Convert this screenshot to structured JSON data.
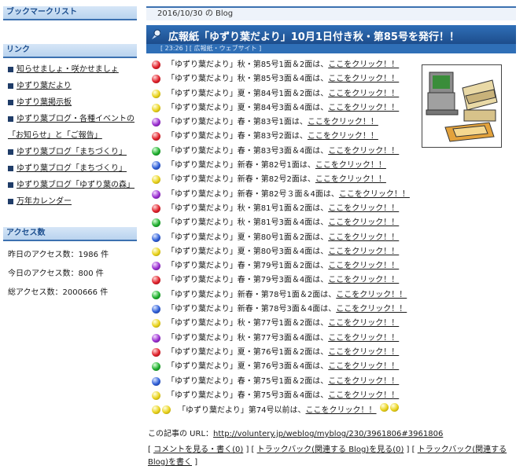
{
  "sidebar": {
    "bookmark_title": "ブックマークリスト",
    "links_title": "リンク",
    "links": [
      "知らせましょ・咲かせましょ",
      "ゆずり葉だより",
      "ゆずり葉掲示板",
      "ゆずり葉ブログ・各種イベントの",
      "「お知らせ」と「ご報告」",
      "ゆずり葉ブログ「まちづくり」",
      "ゆずり葉ブログ「まちづくり」",
      "ゆずり葉ブログ「ゆずり葉の森」",
      "万年カレンダー"
    ],
    "access_title": "アクセス数",
    "access": {
      "yesterday": "昨日のアクセス数：1986 件",
      "today": "今日のアクセス数：800 件",
      "total": "総アクセス数：2000666 件"
    }
  },
  "main": {
    "date_label": "2016/10/30 の Blog",
    "title": "広報紙「ゆずり葉だより」10月1日付き秋・第85号を発行！！",
    "subtitle": "[ 23:26 ] [ 広報紙・ウェブサイト ]",
    "entries": [
      {
        "color": "red",
        "text": "「ゆずり葉だより」秋・第85号1面＆2面は、",
        "link": "ここをクリック！！"
      },
      {
        "color": "red",
        "text": "「ゆずり葉だより」秋・第85号3面＆4面は、",
        "link": "ここをクリック！！"
      },
      {
        "color": "yellow",
        "text": "「ゆずり葉だより」夏・第84号1面＆2面は、",
        "link": "ここをクリック！！"
      },
      {
        "color": "yellow",
        "text": "「ゆずり葉だより」夏・第84号3面＆4面は、",
        "link": "ここをクリック！！"
      },
      {
        "color": "purple",
        "text": "「ゆずり葉だより」春・第83号1面は、",
        "link": "ここをクリック！！"
      },
      {
        "color": "red",
        "text": "「ゆずり葉だより」春・第83号2面は、",
        "link": "ここをクリック！！"
      },
      {
        "color": "green",
        "text": "「ゆずり葉だより」春・第83号3面＆4面は、",
        "link": "ここをクリック！！"
      },
      {
        "color": "blue",
        "text": "「ゆずり葉だより」新春・第82号1面は、",
        "link": "ここをクリック！！"
      },
      {
        "color": "yellow",
        "text": "「ゆずり葉だより」新春・第82号2面は、",
        "link": "ここをクリック！！"
      },
      {
        "color": "purple",
        "text": "「ゆずり葉だより」新春・第82号３面＆4面は、",
        "link": "ここをクリック！！"
      },
      {
        "color": "red",
        "text": "「ゆずり葉だより」秋・第81号1面＆2面は、",
        "link": "ここをクリック！！"
      },
      {
        "color": "green",
        "text": "「ゆずり葉だより」秋・第81号3面＆4面は、",
        "link": "ここをクリック！！"
      },
      {
        "color": "blue",
        "text": "「ゆずり葉だより」夏・第80号1面＆2面は、",
        "link": "ここをクリック！！"
      },
      {
        "color": "yellow",
        "text": "「ゆずり葉だより」夏・第80号3面＆4面は、",
        "link": "ここをクリック！！"
      },
      {
        "color": "purple",
        "text": "「ゆずり葉だより」春・第79号1面＆2面は、",
        "link": "ここをクリック！！"
      },
      {
        "color": "red",
        "text": "「ゆずり葉だより」春・第79号3面＆4面は、",
        "link": "ここをクリック！！"
      },
      {
        "color": "green",
        "text": "「ゆずり葉だより」新春・第78号1面＆2面は、",
        "link": "ここをクリック！！"
      },
      {
        "color": "blue",
        "text": "「ゆずり葉だより」新春・第78号3面＆4面は、",
        "link": "ここをクリック！！"
      },
      {
        "color": "yellow",
        "text": "「ゆずり葉だより」秋・第77号1面＆2面は、",
        "link": "ここをクリック！！"
      },
      {
        "color": "purple",
        "text": "「ゆずり葉だより」秋・第77号3面＆4面は、",
        "link": "ここをクリック！！"
      },
      {
        "color": "red",
        "text": "「ゆずり葉だより」夏・第76号1面＆2面は、",
        "link": "ここをクリック！！"
      },
      {
        "color": "green",
        "text": "「ゆずり葉だより」夏・第76号3面＆4面は、",
        "link": "ここをクリック！！"
      },
      {
        "color": "blue",
        "text": "「ゆずり葉だより」春・第75号1面＆2面は、",
        "link": "ここをクリック！！"
      },
      {
        "color": "yellow",
        "text": "「ゆずり葉だより」春・第75号3面＆4面は、",
        "link": "ここをクリック！！"
      }
    ],
    "last_entry": {
      "text": "「ゆずり葉だより」第74号以前は、",
      "link": "ここをクリック！！"
    }
  },
  "footer": {
    "url_label": "この記事の URL：",
    "url": "http://voluntery.jp/weblog/myblog/230/3961806#3961806",
    "comment_link": "コメントを見る・書く(0)",
    "trackback_view_link": "トラックバック(関連する Blog)を見る(0)",
    "trackback_write_link": "トラックバック(関連する Blog)を書く"
  },
  "colors": {
    "accent": "#2f6fb7",
    "header_bg": "#b9d3ee",
    "text": "#1a1a1a"
  },
  "icons": {
    "title_marker": "pushpin-icon",
    "bullet": "square-bullet-icon",
    "clipart": "office-computer-clipart"
  }
}
